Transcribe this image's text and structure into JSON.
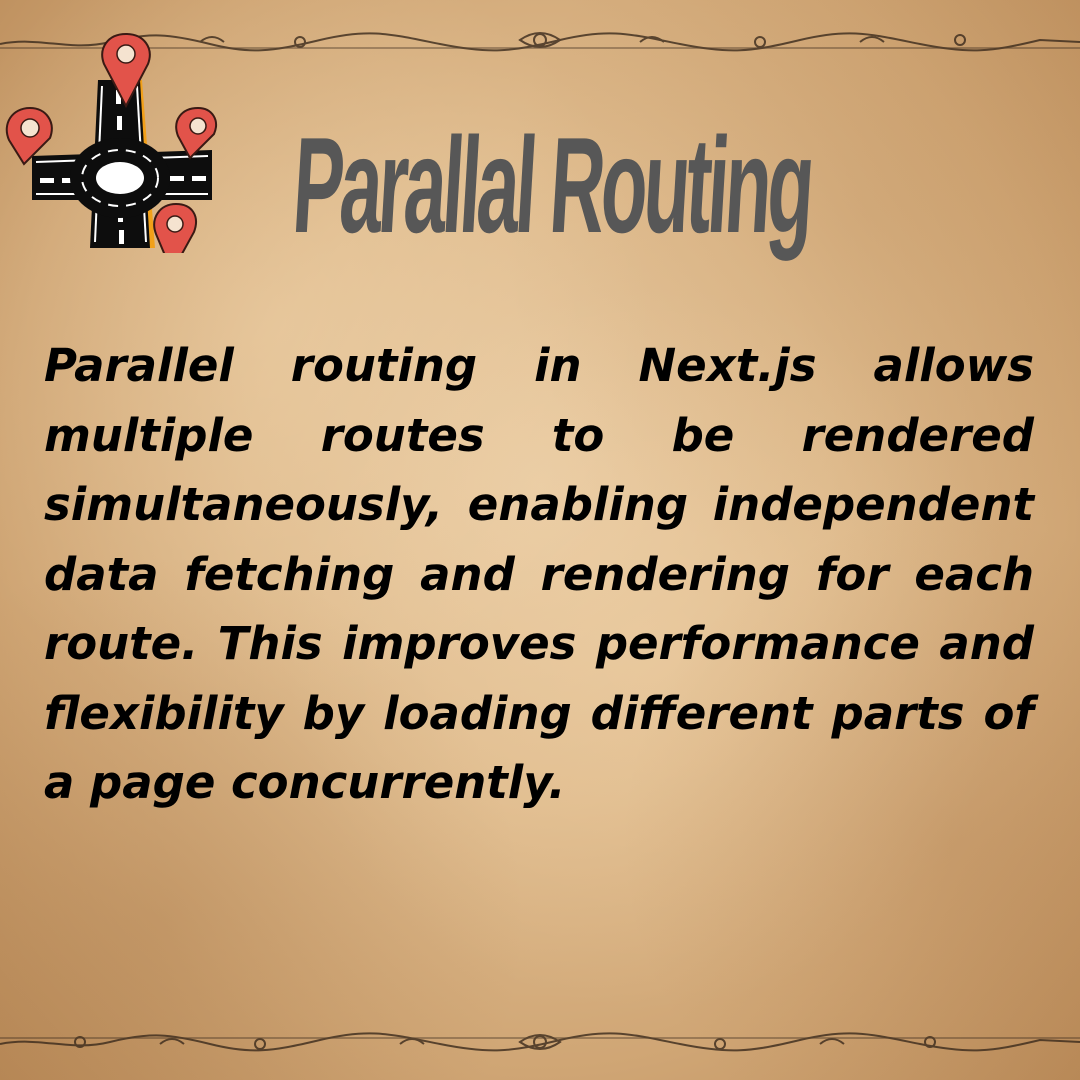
{
  "title": "Parallal Routing",
  "description": "Parallel routing in Next.js allows multiple routes to be rendered simultaneously, enabling independent data fetching and rendering for each route. This improves performance and flexibility by loading different parts of a page concurrently.",
  "logo_icon": "roundabout-with-map-pins-icon",
  "colors": {
    "background": "#e3c195",
    "title": "#575757",
    "text": "#000000",
    "pin": "#e2534a",
    "road": "#0d0d0d",
    "road_accent": "#f2a019"
  }
}
